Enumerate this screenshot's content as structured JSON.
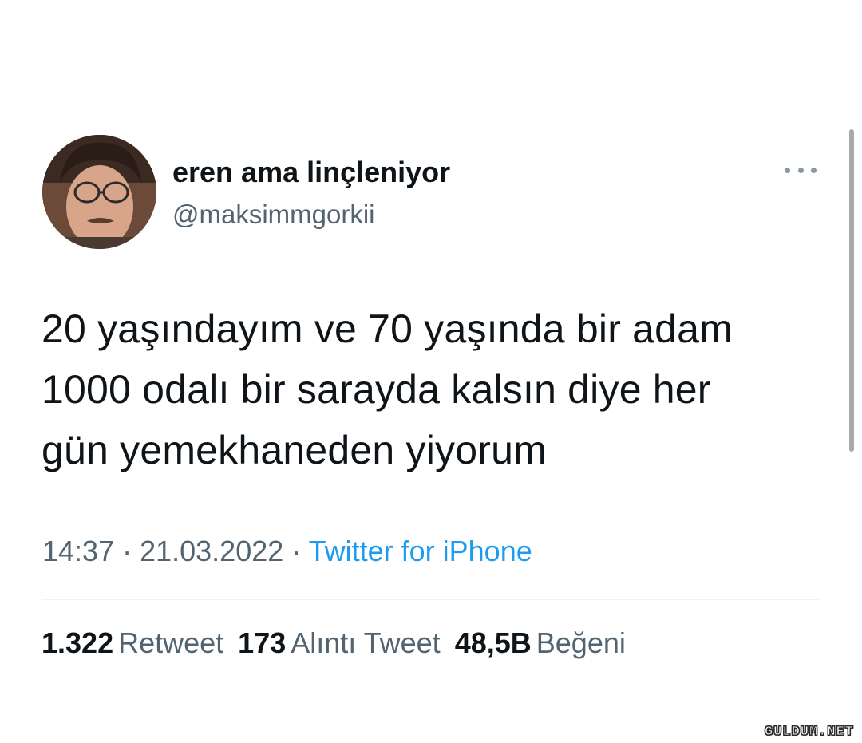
{
  "author": {
    "display_name": "eren ama linçleniyor",
    "handle": "@maksimmgorkii",
    "avatar": "profile-photo"
  },
  "more_button": {
    "icon": "more-horizontal-icon"
  },
  "tweet": {
    "text": "20 yaşındayım ve 70 yaşında bir adam\n1000 odalı bir sarayda kalsın diye her\ngün yemekhaneden yiyorum"
  },
  "meta": {
    "time": "14:37",
    "separator1": " · ",
    "date": "21.03.2022",
    "separator2": " · ",
    "source": "Twitter for iPhone"
  },
  "stats": {
    "retweets": {
      "count": "1.322",
      "label": "Retweet"
    },
    "quotes": {
      "count": "173",
      "label": "Alıntı Tweet"
    },
    "likes": {
      "count": "48,5B",
      "label": "Beğeni"
    }
  },
  "watermark": "GULDUM.NET",
  "colors": {
    "text_primary": "#0f1419",
    "text_secondary": "#536471",
    "link": "#1d9bf0",
    "divider": "#eff3f4"
  }
}
